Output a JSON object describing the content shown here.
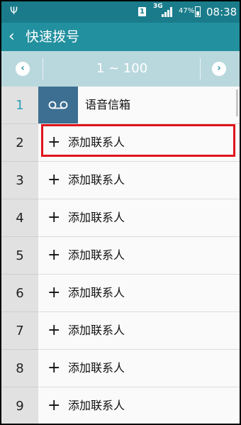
{
  "status_bar": {
    "sim_label": "1",
    "network": "3G",
    "battery_percent": "47%",
    "time": "08:38",
    "icons": [
      "usb-icon",
      "sim-icon",
      "signal-icon",
      "battery-icon"
    ]
  },
  "action_bar": {
    "back_icon": "chevron-left-icon",
    "title": "快速拨号"
  },
  "range_bar": {
    "prev_icon": "chevron-left-circle-icon",
    "next_icon": "chevron-right-circle-icon",
    "range": "1 ~ 100"
  },
  "list": {
    "voicemail": {
      "number": "1",
      "label": "语音信箱",
      "icon": "voicemail-icon"
    },
    "rows": [
      {
        "number": "2",
        "label": "添加联系人"
      },
      {
        "number": "3",
        "label": "添加联系人"
      },
      {
        "number": "4",
        "label": "添加联系人"
      },
      {
        "number": "5",
        "label": "添加联系人"
      },
      {
        "number": "6",
        "label": "添加联系人"
      },
      {
        "number": "7",
        "label": "添加联系人"
      },
      {
        "number": "8",
        "label": "添加联系人"
      },
      {
        "number": "9",
        "label": "添加联系人"
      }
    ],
    "add_icon": "plus-icon"
  },
  "colors": {
    "status_bar": "#1a7c8b",
    "action_bar": "#22909f",
    "range_bar": "#b9d8dd",
    "highlight": "#e0141b"
  }
}
